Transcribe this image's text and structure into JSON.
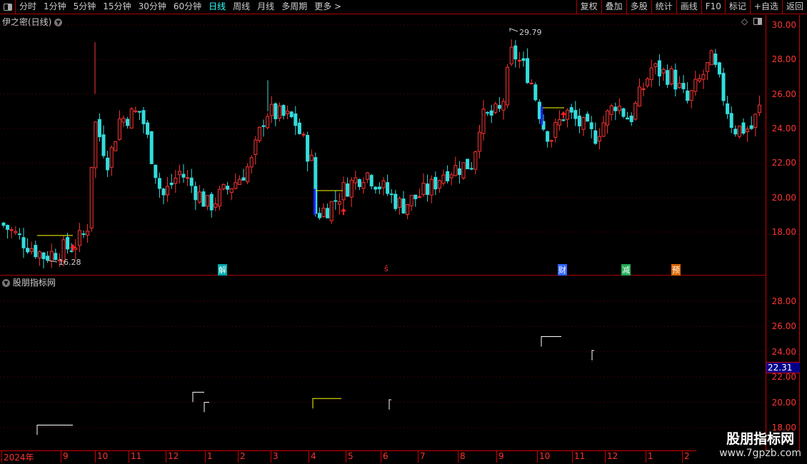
{
  "toolbar": {
    "periods": [
      "分时",
      "1分钟",
      "5分钟",
      "15分钟",
      "30分钟",
      "60分钟",
      "日线",
      "周线",
      "月线",
      "多周期",
      "更多 >"
    ],
    "active": "日线",
    "right": [
      "复权",
      "叠加",
      "多股",
      "统计",
      "画线",
      "F10",
      "标记",
      "+自选",
      "返回"
    ]
  },
  "main_panel": {
    "title": "伊之密(日线)",
    "high_label": "29.79",
    "low_label": "16.28",
    "y_ticks": [
      "30.00",
      "28.00",
      "26.00",
      "24.00",
      "22.00",
      "20.00",
      "18.00"
    ],
    "events": [
      {
        "t": "解",
        "c": "#0aa"
      },
      {
        "t": "ŝ",
        "c": "#f33"
      },
      {
        "t": "财",
        "c": "#36f"
      },
      {
        "t": "减",
        "c": "#2a5"
      },
      {
        "t": "预",
        "c": "#d60"
      }
    ]
  },
  "sub_panel": {
    "title": "股朋指标网",
    "y_ticks": [
      "28.00",
      "26.00",
      "24.00",
      "22.00",
      "20.00",
      "18.00"
    ],
    "current_value": "22.31"
  },
  "x_axis": [
    "2024年",
    "9",
    "10",
    "11",
    "12",
    "1",
    "2",
    "3",
    "4",
    "5",
    "6",
    "7",
    "8",
    "9",
    "10",
    "11",
    "12",
    "1",
    "2"
  ],
  "watermark": {
    "name": "股朋指标网",
    "url": "www.7gpzb.com"
  },
  "colors": {
    "up": "#ff3333",
    "down": "#33dddd",
    "accent": "#cc0000"
  },
  "chart_data": {
    "type": "candlestick",
    "y_range": [
      17,
      30.5
    ],
    "high": 29.79,
    "low": 16.28,
    "approx_close_path": [
      18.5,
      17.5,
      16.6,
      17.2,
      18,
      24.5,
      22,
      24.5,
      25,
      20,
      21.5,
      19.5,
      21,
      22,
      25,
      24.5,
      22,
      19,
      19.5,
      20.5,
      21.5,
      19.5,
      20.5,
      21.5,
      22,
      24.5,
      25,
      28.5,
      27,
      24,
      23.5,
      25,
      23.5,
      25.5,
      24.5,
      27.5,
      27,
      25.5,
      28,
      24,
      24,
      25.5
    ]
  }
}
